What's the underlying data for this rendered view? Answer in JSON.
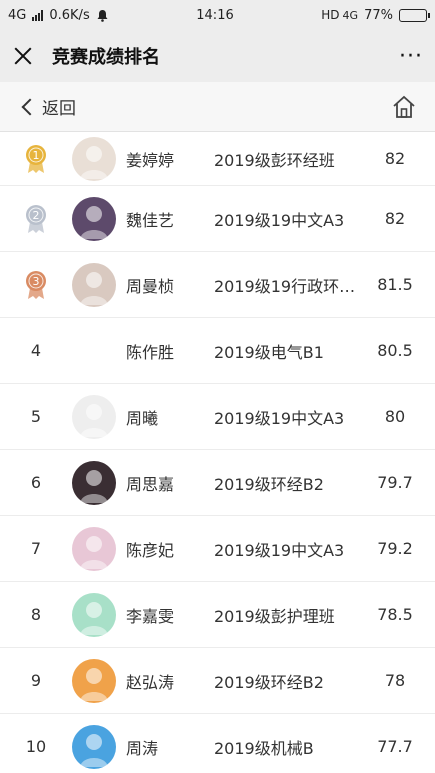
{
  "status": {
    "network": "4G",
    "speed": "0.6K/s",
    "time": "14:16",
    "hd": "HD",
    "net2": "4G",
    "battery": "77%",
    "battery_level": 0.77
  },
  "titlebar": {
    "title": "竞赛成绩排名",
    "more": "···"
  },
  "nav": {
    "back_label": "返回"
  },
  "colors": {
    "gold": "#e7b43c",
    "silver": "#b9c0cc",
    "bronze": "#d98b63"
  },
  "rows": [
    {
      "rank": "1",
      "medal": "gold",
      "name": "姜婷婷",
      "cls": "2019级彭环经班",
      "score": "82",
      "avatar_bg": "#e9dfd6",
      "avatar": "person-photo"
    },
    {
      "rank": "2",
      "medal": "silver",
      "name": "魏佳艺",
      "cls": "2019级19中文A3",
      "score": "82",
      "avatar_bg": "#5d4a6b",
      "avatar": "person-photo"
    },
    {
      "rank": "3",
      "medal": "bronze",
      "name": "周曼桢",
      "cls": "2019级19行政环…",
      "score": "81.5",
      "avatar_bg": "#d9c9c0",
      "avatar": "person-photo"
    },
    {
      "rank": "4",
      "medal": "",
      "name": "陈作胜",
      "cls": "2019级电气B1",
      "score": "80.5",
      "avatar_bg": "#ffffff",
      "avatar": "pikachu"
    },
    {
      "rank": "5",
      "medal": "",
      "name": "周曦",
      "cls": "2019级19中文A3",
      "score": "80",
      "avatar_bg": "#eeeeee",
      "avatar": "cartoon"
    },
    {
      "rank": "6",
      "medal": "",
      "name": "周思嘉",
      "cls": "2019级环经B2",
      "score": "79.7",
      "avatar_bg": "#3a2e33",
      "avatar": "anime-girl"
    },
    {
      "rank": "7",
      "medal": "",
      "name": "陈彦妃",
      "cls": "2019级19中文A3",
      "score": "79.2",
      "avatar_bg": "#e8c7d6",
      "avatar": "anime-girl"
    },
    {
      "rank": "8",
      "medal": "",
      "name": "李嘉雯",
      "cls": "2019级彭护理班",
      "score": "78.5",
      "avatar_bg": "#a8e0c8",
      "avatar": "crayon-shin"
    },
    {
      "rank": "9",
      "medal": "",
      "name": "赵弘涛",
      "cls": "2019级环经B2",
      "score": "78",
      "avatar_bg": "#f0a24a",
      "avatar": "luffy"
    },
    {
      "rank": "10",
      "medal": "",
      "name": "周涛",
      "cls": "2019级机械B",
      "score": "77.7",
      "avatar_bg": "#4aa3e0",
      "avatar": "stitch"
    }
  ]
}
